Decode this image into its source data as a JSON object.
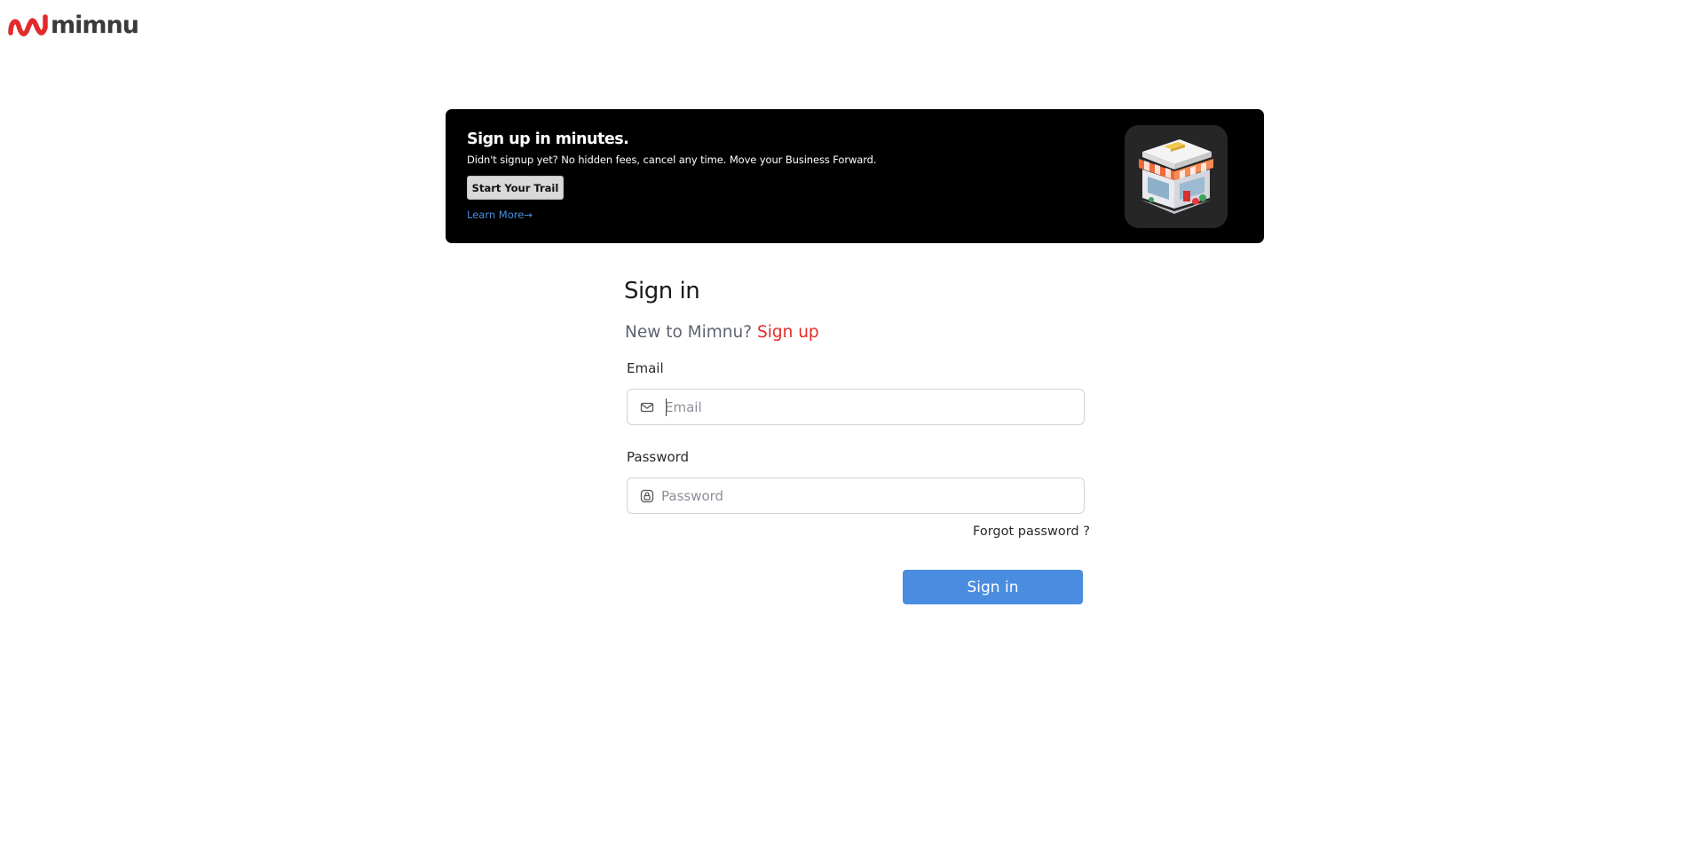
{
  "brand": {
    "name": "mimnu",
    "accent_color": "#e22b2b"
  },
  "banner": {
    "title": "Sign up in minutes.",
    "subtitle": "Didn't signup yet? No hidden fees, cancel any time. Move your Business Forward.",
    "cta_label": "Start Your Trail",
    "link_label": "Learn More→",
    "image_icon": "storefront-icon"
  },
  "signin": {
    "title": "Sign in",
    "new_prompt": "New to Mimnu?",
    "signup_label": "Sign up",
    "email": {
      "label": "Email",
      "placeholder": "Email",
      "value": "",
      "icon": "mail-icon"
    },
    "password": {
      "label": "Password",
      "placeholder": "Password",
      "value": "",
      "icon": "lock-icon"
    },
    "forgot_label": "Forgot password ?",
    "submit_label": "Sign in",
    "submit_color": "#4a8de0"
  }
}
